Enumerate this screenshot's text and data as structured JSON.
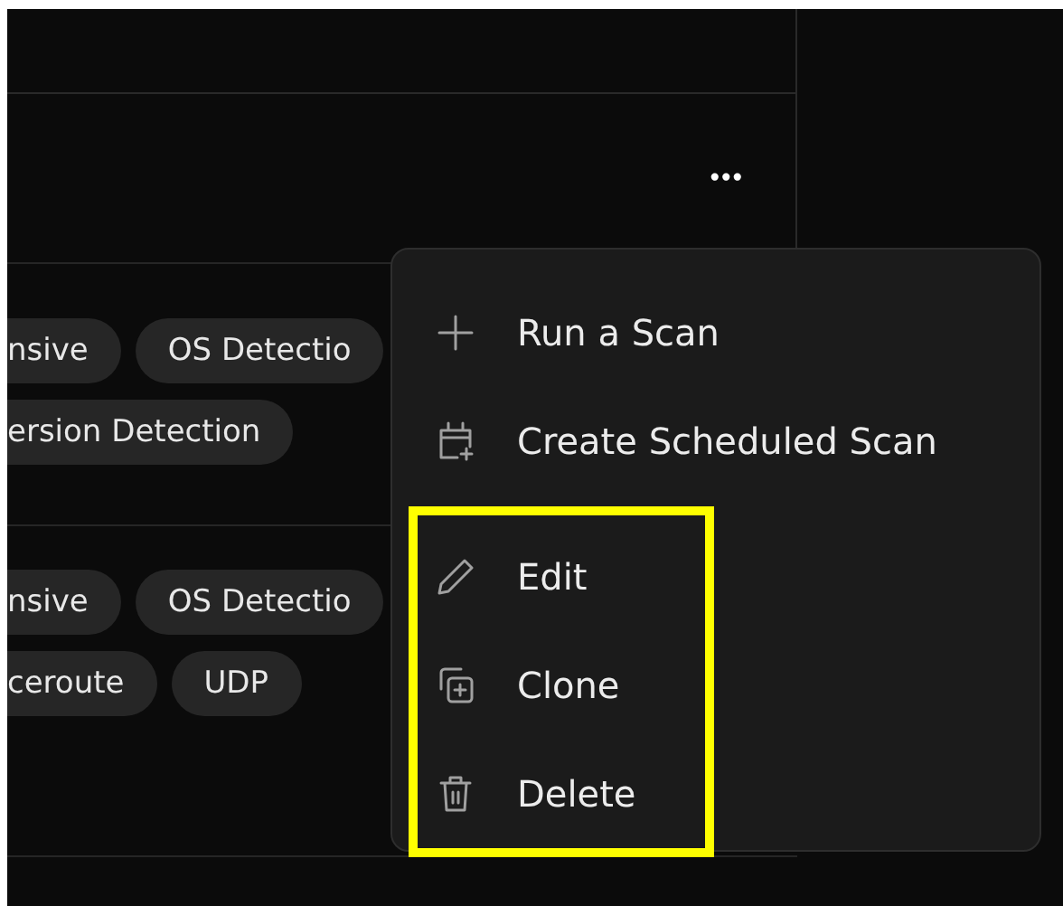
{
  "more_button": {
    "label": "•••"
  },
  "scan_rows": [
    {
      "tag_lines": [
        [
          {
            "label": "nsive",
            "clipped": true
          },
          {
            "label": "OS Detectio",
            "clipped": false
          }
        ],
        [
          {
            "label": "ersion Detection",
            "clipped": true
          }
        ]
      ]
    },
    {
      "tag_lines": [
        [
          {
            "label": "nsive",
            "clipped": true
          },
          {
            "label": "OS Detectio",
            "clipped": false
          }
        ],
        [
          {
            "label": "ceroute",
            "clipped": true
          },
          {
            "label": "UDP",
            "clipped": false
          }
        ]
      ]
    }
  ],
  "menu": {
    "groups": [
      {
        "highlighted": false,
        "items": [
          {
            "label": "Run a Scan"
          },
          {
            "label": "Create Scheduled Scan"
          }
        ]
      },
      {
        "highlighted": true,
        "items": [
          {
            "label": "Edit"
          },
          {
            "label": "Clone"
          },
          {
            "label": "Delete"
          }
        ]
      }
    ]
  }
}
